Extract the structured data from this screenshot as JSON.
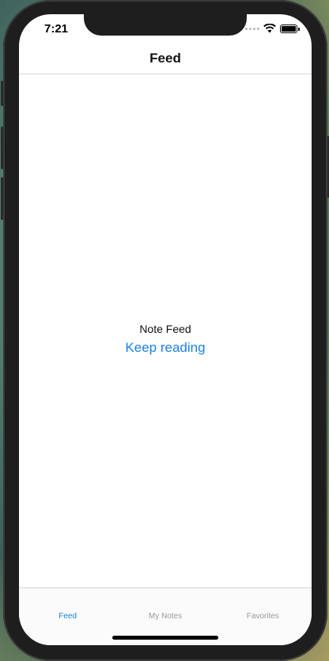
{
  "status_bar": {
    "time": "7:21"
  },
  "nav": {
    "title": "Feed"
  },
  "main": {
    "label": "Note Feed",
    "link": "Keep reading"
  },
  "tabs": [
    {
      "label": "Feed",
      "active": true
    },
    {
      "label": "My Notes",
      "active": false
    },
    {
      "label": "Favorites",
      "active": false
    }
  ],
  "colors": {
    "accent": "#1a82e2",
    "inactive_tab": "#999999"
  }
}
